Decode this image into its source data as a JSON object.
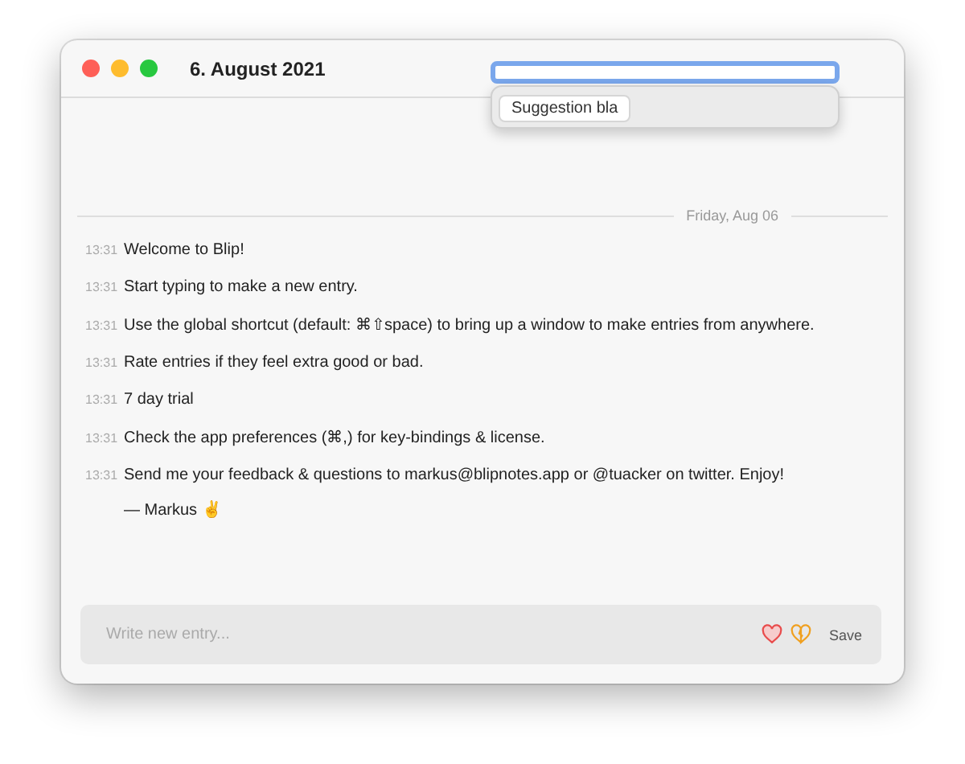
{
  "window": {
    "title": "6. August 2021"
  },
  "search": {
    "focused": true,
    "suggestions": [
      "Suggestion bla"
    ]
  },
  "day_divider": "Friday, Aug 06",
  "entries": [
    {
      "time": "13:31",
      "text": "Welcome to Blip!"
    },
    {
      "time": "13:31",
      "text": "Start typing to make a new entry."
    },
    {
      "time": "13:31",
      "text": "Use the global shortcut (default: ⌘⇧space) to bring up a window to make entries from anywhere."
    },
    {
      "time": "13:31",
      "text": "Rate entries if they feel extra good or bad."
    },
    {
      "time": "13:31",
      "text": "7 day trial"
    },
    {
      "time": "13:31",
      "text": "Check the app preferences (⌘,) for key-bindings & license."
    },
    {
      "time": "13:31",
      "text": "Send me your feedback & questions to markus@blipnotes.app or @tuacker on twitter. Enjoy!",
      "signature": "— Markus ✌"
    }
  ],
  "composer": {
    "placeholder": "Write new entry...",
    "save": "Save"
  }
}
